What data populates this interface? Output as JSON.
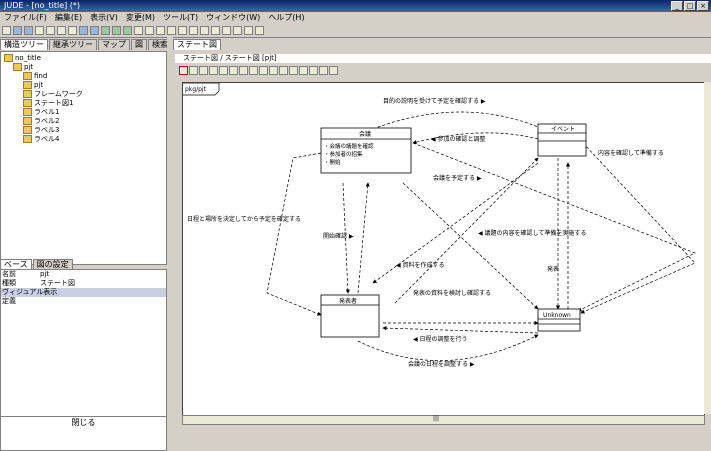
{
  "window": {
    "title": "JUDE - [no_title] (*)"
  },
  "menu": [
    "ファイル(F)",
    "編集(E)",
    "表示(V)",
    "変更(M)",
    "ツール(T)",
    "ウィンドウ(W)",
    "ヘルプ(H)"
  ],
  "left_tabs": [
    "構造ツリー",
    "継承ツリー",
    "マップ",
    "図",
    "検索"
  ],
  "tree": {
    "root": "no_title",
    "package": "pjt",
    "items": [
      "find",
      "pjt",
      "フレームワーク",
      "ステート図1",
      "ラベル1",
      "ラベル2",
      "ラベル3",
      "ラベル4"
    ]
  },
  "props_tabs": [
    "ベース",
    "図の設定"
  ],
  "props": [
    {
      "k": "名前",
      "v": "pjt"
    },
    {
      "k": "種類",
      "v": "ステート図"
    },
    {
      "k": "ヴィジュアル表示",
      "v": ""
    },
    {
      "k": "定義",
      "v": ""
    }
  ],
  "left_bottom_label": "閉じる",
  "right_tabs": [
    "ステート図"
  ],
  "diagram_title": "ステート図 / ステート図 [pjt]",
  "frame_label": "pkg/pjt",
  "states": {
    "main": {
      "name": "会議",
      "lines": [
        "・会議の議題を確認",
        "・参加者の招集",
        "・開始"
      ]
    },
    "top_right": {
      "name": "イベント"
    },
    "bottom_left": {
      "name": "発表者"
    },
    "bottom_right": {
      "name": "Unknown"
    }
  },
  "labels": {
    "l1": "目的の説明を受けて予定を確認する ▶",
    "l2": "◀ 参加の確認と調整",
    "l3": "会議を予定する ▶",
    "l4": "内容を確認して準備する",
    "l5": "日程と場所を決定してから予定を確定する",
    "l6": "開始確認 ▶",
    "l7": "◀ 資料を作成する",
    "l8": "◀ 議題の内容を確認して準備を実施する",
    "l9": "発表",
    "l10": "発表の資料を検討し確認する",
    "l11": "◀ 日程の調整を行う",
    "l12": "会議の日程を調整する ▶"
  },
  "status_left": "|||"
}
